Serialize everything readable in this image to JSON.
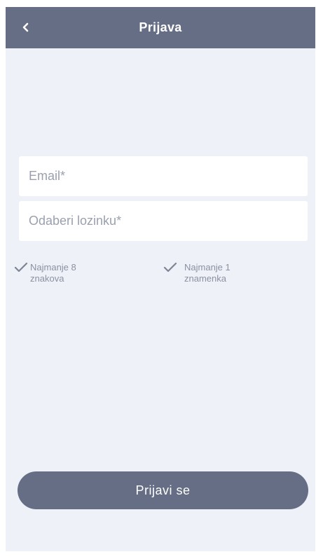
{
  "header": {
    "title": "Prijava",
    "back_icon": "chevron-left-icon"
  },
  "form": {
    "email_placeholder": "Email*",
    "password_placeholder": "Odaberi lozinku*"
  },
  "password_rules": [
    {
      "icon": "checkmark-icon",
      "label": "Najmanje 8 znakova"
    },
    {
      "icon": "checkmark-icon",
      "label": "Najmanje 1 znamenka"
    }
  ],
  "submit": {
    "label": "Prijavi se"
  },
  "colors": {
    "header_bg": "#666e85",
    "background": "#eef1f8",
    "button_bg": "#666e85",
    "rule_text": "#8b91a0"
  }
}
